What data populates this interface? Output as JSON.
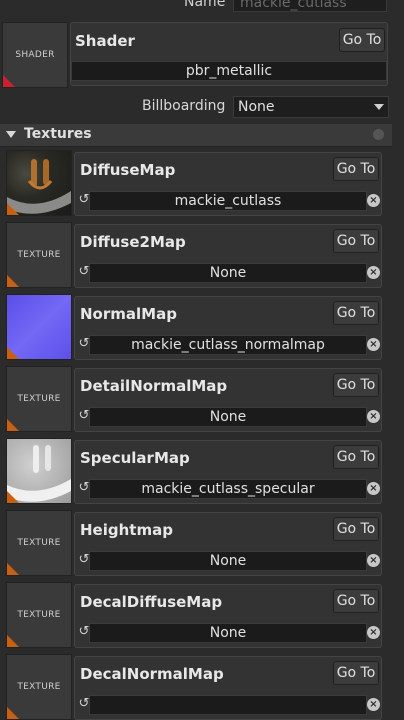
{
  "header": {
    "name_label": "Name",
    "name_value": "mackie_cutlass"
  },
  "shader": {
    "thumb_text": "SHADER",
    "title": "Shader",
    "goto": "Go To",
    "value": "pbr_metallic"
  },
  "billboarding": {
    "label": "Billboarding",
    "value": "None"
  },
  "textures": {
    "title": "Textures",
    "generic_thumb_text": "TEXTURE",
    "slots": [
      {
        "title": "DiffuseMap",
        "goto": "Go To",
        "value": "mackie_cutlass",
        "thumb": "diffuse"
      },
      {
        "title": "Diffuse2Map",
        "goto": "Go To",
        "value": "None",
        "thumb": "generic"
      },
      {
        "title": "NormalMap",
        "goto": "Go To",
        "value": "mackie_cutlass_normalmap",
        "thumb": "normal"
      },
      {
        "title": "DetailNormalMap",
        "goto": "Go To",
        "value": "None",
        "thumb": "generic"
      },
      {
        "title": "SpecularMap",
        "goto": "Go To",
        "value": "mackie_cutlass_specular",
        "thumb": "specular"
      },
      {
        "title": "Heightmap",
        "goto": "Go To",
        "value": "None",
        "thumb": "generic"
      },
      {
        "title": "DecalDiffuseMap",
        "goto": "Go To",
        "value": "None",
        "thumb": "generic"
      },
      {
        "title": "DecalNormalMap",
        "goto": "Go To",
        "value": "",
        "thumb": "generic"
      }
    ]
  },
  "colors": {
    "background": "#2b2b2b",
    "corner_marker": "#c86010",
    "shader_marker": "#cc2030",
    "normal_thumb": "#6a5cf0"
  }
}
